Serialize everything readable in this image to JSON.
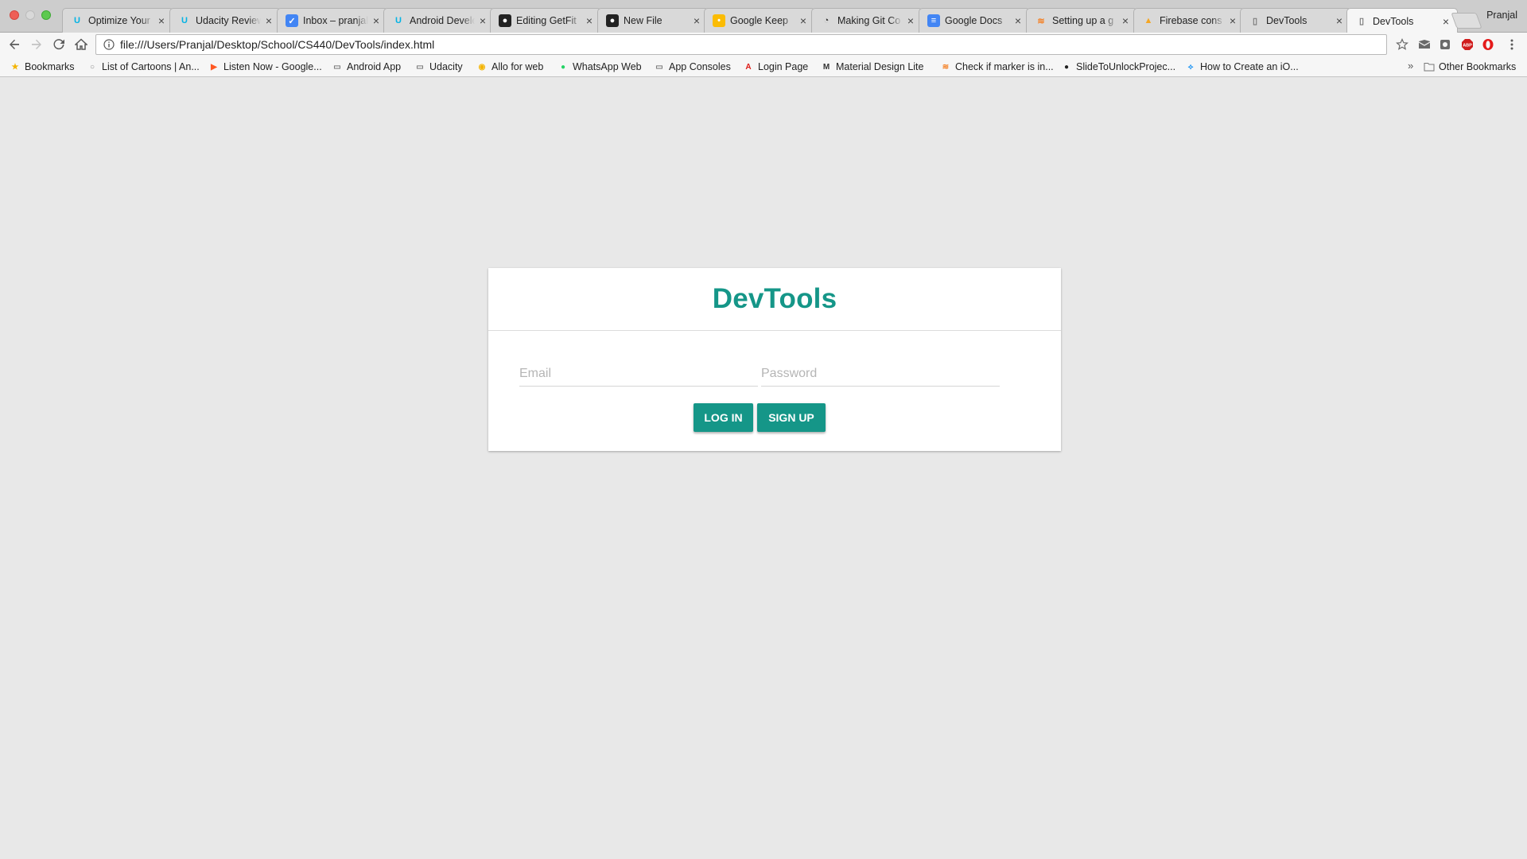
{
  "browser": {
    "tabs": [
      {
        "title": "Optimize Your",
        "icon": "udacity-icon",
        "active": false
      },
      {
        "title": "Udacity Reviews",
        "icon": "udacity-icon",
        "active": false
      },
      {
        "title": "Inbox – pranjal",
        "icon": "inbox-icon",
        "active": false
      },
      {
        "title": "Android Developer",
        "icon": "udacity-icon",
        "active": false
      },
      {
        "title": "Editing GetFit",
        "icon": "github-icon",
        "active": false
      },
      {
        "title": "New File",
        "icon": "github-icon",
        "active": false
      },
      {
        "title": "Google Keep",
        "icon": "keep-icon",
        "active": false
      },
      {
        "title": "Making Git Co",
        "icon": "git-icon",
        "active": false
      },
      {
        "title": "Google Docs",
        "icon": "docs-icon",
        "active": false
      },
      {
        "title": "Setting up a g",
        "icon": "stackoverflow-icon",
        "active": false
      },
      {
        "title": "Firebase cons",
        "icon": "firebase-icon",
        "active": false
      },
      {
        "title": "DevTools",
        "icon": "page-icon",
        "active": false
      },
      {
        "title": "DevTools",
        "icon": "page-icon",
        "active": true
      }
    ],
    "close_glyph": "×",
    "profile_name": "Pranjal",
    "address": "file:///Users/Pranjal/Desktop/School/CS440/DevTools/index.html",
    "bookmarks": [
      {
        "label": "Bookmarks",
        "icon": "star-icon"
      },
      {
        "label": "List of Cartoons | An...",
        "icon": "globe-icon"
      },
      {
        "label": "Listen Now - Google...",
        "icon": "play-music-icon"
      },
      {
        "label": "Android App",
        "icon": "folder-icon"
      },
      {
        "label": "Udacity",
        "icon": "folder-icon"
      },
      {
        "label": "Allo for web",
        "icon": "allo-icon"
      },
      {
        "label": "WhatsApp Web",
        "icon": "whatsapp-icon"
      },
      {
        "label": "App Consoles",
        "icon": "folder-icon"
      },
      {
        "label": "Login Page",
        "icon": "angular-icon"
      },
      {
        "label": "Material Design Lite",
        "icon": "mdl-icon"
      },
      {
        "label": "Check if marker is in...",
        "icon": "stackoverflow-icon"
      },
      {
        "label": "SlideToUnlockProjec...",
        "icon": "github-icon"
      },
      {
        "label": "How to Create an iO...",
        "icon": "swift-icon"
      }
    ],
    "more_bookmarks": "»",
    "other_bookmarks": "Other Bookmarks"
  },
  "page": {
    "title": "DevTools",
    "email_placeholder": "Email",
    "email_value": "",
    "password_placeholder": "Password",
    "password_value": "",
    "login_label": "Log In",
    "signup_label": "Sign Up"
  },
  "colors": {
    "accent": "#159688",
    "page_background": "#e8e8e8"
  }
}
